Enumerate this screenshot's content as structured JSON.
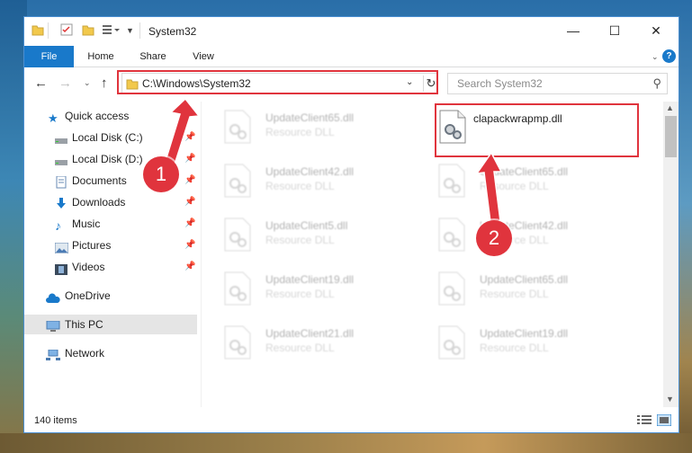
{
  "window": {
    "title": "System32",
    "controls": {
      "minimize": "—",
      "maximize": "☐",
      "close": "✕"
    }
  },
  "ribbon": {
    "tabs": [
      "File",
      "Home",
      "Share",
      "View"
    ],
    "help": "?"
  },
  "address_bar": {
    "path": "C:\\Windows\\System32",
    "search_placeholder": "Search System32"
  },
  "sidebar": {
    "items": [
      {
        "label": "Quick access",
        "icon": "star-icon",
        "pinned": false
      },
      {
        "label": "Local Disk (C:)",
        "icon": "drive-icon",
        "pinned": true
      },
      {
        "label": "Local Disk (D:)",
        "icon": "drive-icon",
        "pinned": true
      },
      {
        "label": "Documents",
        "icon": "documents-icon",
        "pinned": true
      },
      {
        "label": "Downloads",
        "icon": "download-icon",
        "pinned": true
      },
      {
        "label": "Music",
        "icon": "music-icon",
        "pinned": true
      },
      {
        "label": "Pictures",
        "icon": "pictures-icon",
        "pinned": true
      },
      {
        "label": "Videos",
        "icon": "videos-icon",
        "pinned": true
      },
      {
        "label": "OneDrive",
        "icon": "cloud-icon",
        "pinned": false
      },
      {
        "label": "This PC",
        "icon": "computer-icon",
        "pinned": false,
        "selected": true
      },
      {
        "label": "Network",
        "icon": "network-icon",
        "pinned": false
      }
    ]
  },
  "files": {
    "left_column": [
      {
        "name": "UpdateClient65.dll",
        "type": "Resource DLL"
      },
      {
        "name": "UpdateClient42.dll",
        "type": "Resource DLL"
      },
      {
        "name": "UpdateClient5.dll",
        "type": "Resource DLL"
      },
      {
        "name": "UpdateClient19.dll",
        "type": "Resource DLL"
      },
      {
        "name": "UpdateClient21.dll",
        "type": "Resource DLL"
      }
    ],
    "right_column": [
      {
        "name": "clapackwrapmp.dll",
        "type": ""
      },
      {
        "name": "UpdateClient65.dll",
        "type": "Resource DLL"
      },
      {
        "name": "UpdateClient42.dll",
        "type": "Resource DLL"
      },
      {
        "name": "UpdateClient65.dll",
        "type": "Resource DLL"
      },
      {
        "name": "UpdateClient19.dll",
        "type": "Resource DLL"
      }
    ]
  },
  "status": {
    "item_count": "140 items"
  },
  "annotations": {
    "badge1": "1",
    "badge2": "2",
    "color": "#e0343d"
  },
  "colors": {
    "accent": "#1979ca",
    "annotation": "#e0343d"
  }
}
